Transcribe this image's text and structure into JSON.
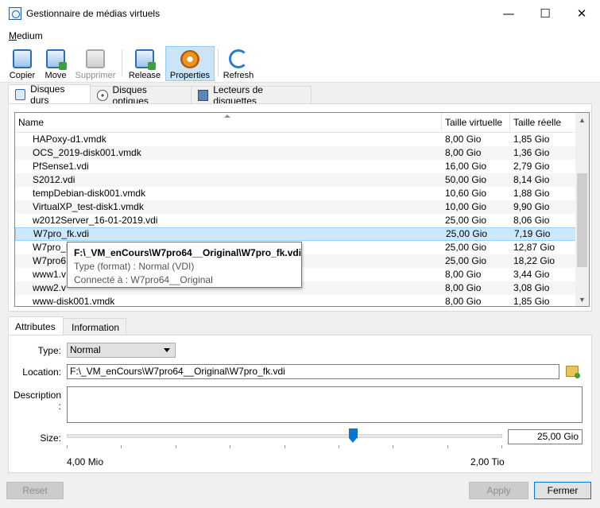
{
  "window": {
    "title": "Gestionnaire de médias virtuels"
  },
  "menu": {
    "medium": {
      "first": "M",
      "rest": "edium"
    }
  },
  "toolbar": {
    "copy": "Copier",
    "move": "Move",
    "delete": "Supprimer",
    "release": "Release",
    "properties": "Properties",
    "refresh": "Refresh"
  },
  "media_tabs": [
    "Disques durs",
    "Disques optiques",
    "Lecteurs de disquettes"
  ],
  "table": {
    "columns": [
      "Name",
      "Taille virtuelle",
      "Taille réelle"
    ],
    "rows": [
      {
        "name": "HAPoxy-d1.vmdk",
        "virtual": "8,00 Gio",
        "actual": "1,85 Gio"
      },
      {
        "name": "OCS_2019-disk001.vmdk",
        "virtual": "8,00 Gio",
        "actual": "1,36 Gio"
      },
      {
        "name": "PfSense1.vdi",
        "virtual": "16,00 Gio",
        "actual": "2,79 Gio"
      },
      {
        "name": "S2012.vdi",
        "virtual": "50,00 Gio",
        "actual": "8,14 Gio"
      },
      {
        "name": "tempDebian-disk001.vmdk",
        "virtual": "10,60 Gio",
        "actual": "1,88 Gio"
      },
      {
        "name": "VirtualXP_test-disk1.vmdk",
        "virtual": "10,00 Gio",
        "actual": "9,90 Gio"
      },
      {
        "name": "w2012Server_16-01-2019.vdi",
        "virtual": "25,00 Gio",
        "actual": "8,06 Gio"
      },
      {
        "name": "W7pro_fk.vdi",
        "virtual": "25,00 Gio",
        "actual": "7,19 Gio"
      },
      {
        "name": "W7pro_l",
        "virtual": "25,00 Gio",
        "actual": "12,87 Gio"
      },
      {
        "name": "W7pro6",
        "virtual": "25,00 Gio",
        "actual": "18,22 Gio"
      },
      {
        "name": "www1.v",
        "virtual": "8,00 Gio",
        "actual": "3,44 Gio"
      },
      {
        "name": "www2.v",
        "virtual": "8,00 Gio",
        "actual": "3,08 Gio"
      },
      {
        "name": "www-disk001.vmdk",
        "virtual": "8,00 Gio",
        "actual": "1,85 Gio"
      }
    ],
    "selected_index": 7
  },
  "tooltip": {
    "path": "F:\\_VM_enCours\\W7pro64__Original\\W7pro_fk.vdi",
    "type_line": "Type (format) :  Normal (VDI)",
    "attached_line": "Connecté à : W7pro64__Original"
  },
  "detail_tabs": [
    "Attributes",
    "Information"
  ],
  "attributes": {
    "type_label": "Type:",
    "type_value": "Normal",
    "location_label": "Location:",
    "location_value": "F:\\_VM_enCours\\W7pro64__Original\\W7pro_fk.vdi",
    "description_label": "Description :",
    "description_value": "",
    "size_label": "Size:",
    "size_value": "25,00 Gio",
    "size_min": "4,00 Mio",
    "size_max": "2,00 Tio",
    "size_slider_fraction": 0.658
  },
  "buttons": {
    "reset": "Reset",
    "apply": "Apply",
    "close": "Fermer"
  }
}
